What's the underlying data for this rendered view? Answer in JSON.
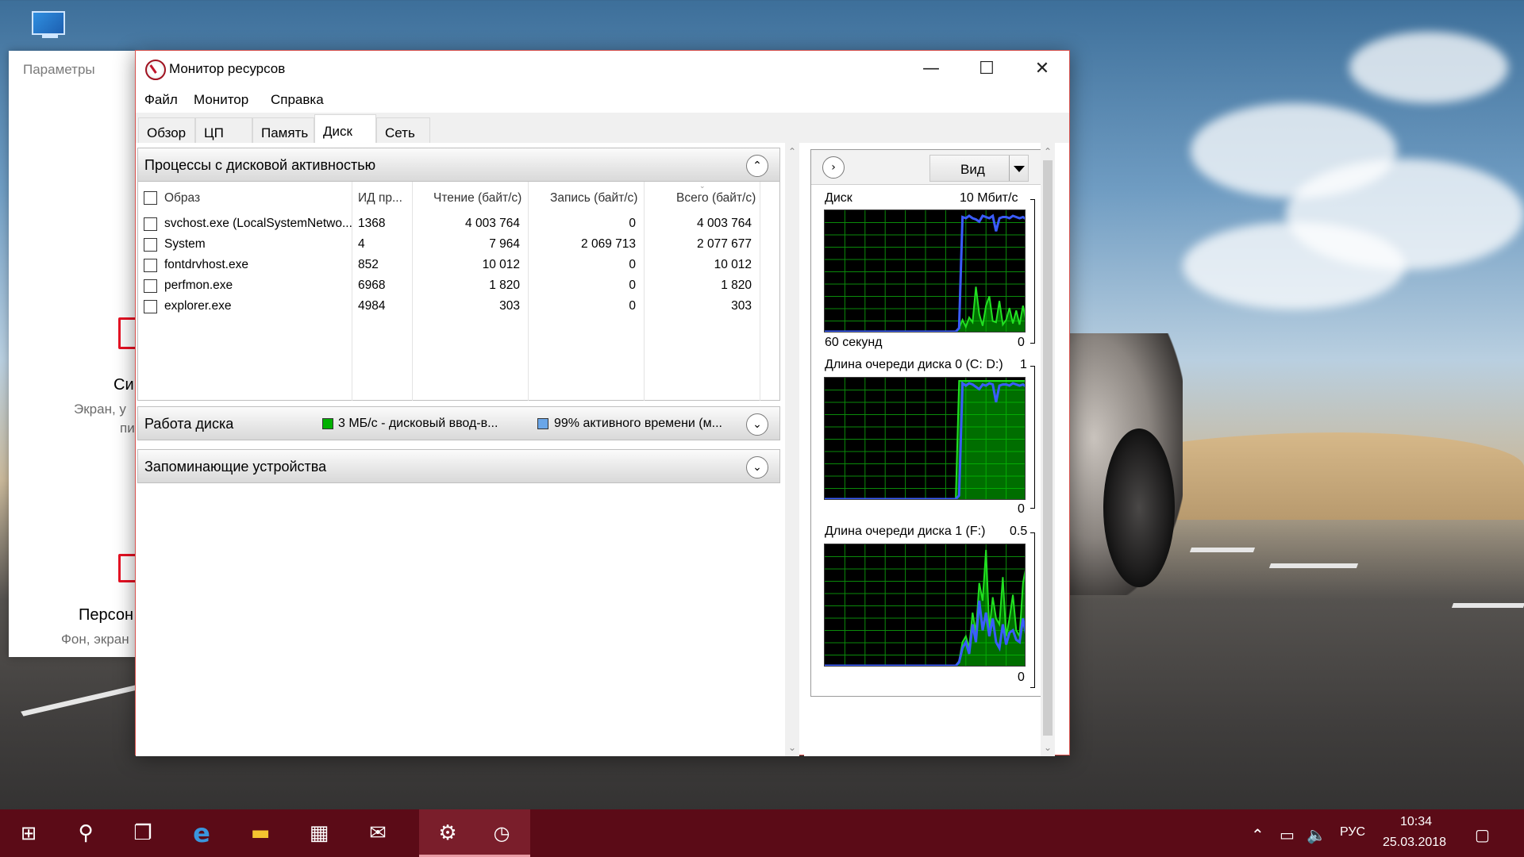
{
  "desktop": {
    "icon": "computer-icon"
  },
  "settings_window": {
    "title": "Параметры",
    "item1_title": "Си",
    "item1_sub_line1": "Экран, у",
    "item1_sub_line2": "пи",
    "item2_title": "Персон",
    "item2_sub": "Фон, экран"
  },
  "window": {
    "title": "Монитор ресурсов",
    "minimize": "—",
    "maximize": "☐",
    "close": "✕",
    "menu": [
      "Файл",
      "Монитор",
      "Справка"
    ],
    "tabs": [
      "Обзор",
      "ЦП",
      "Память",
      "Диск",
      "Сеть"
    ],
    "active_tab": "Диск"
  },
  "processes": {
    "title": "Процессы с дисковой активностью",
    "toggle": "⌃",
    "columns": [
      "Образ",
      "ИД пр...",
      "Чтение (байт/с)",
      "Запись (байт/с)",
      "Всего (байт/с)"
    ],
    "rows": [
      [
        "svchost.exe (LocalSystemNetwo...",
        "1368",
        "4 003 764",
        "0",
        "4 003 764"
      ],
      [
        "System",
        "4",
        "7 964",
        "2 069 713",
        "2 077 677"
      ],
      [
        "fontdrvhost.exe",
        "852",
        "10 012",
        "0",
        "10 012"
      ],
      [
        "perfmon.exe",
        "6968",
        "1 820",
        "0",
        "1 820"
      ],
      [
        "explorer.exe",
        "4984",
        "303",
        "0",
        "303"
      ]
    ]
  },
  "disk_activity": {
    "title": "Работа диска",
    "legend1": "3 МБ/с - дисковый ввод-в...",
    "legend1_color": "#00b000",
    "legend2": "99% активного времени (м...",
    "legend2_color": "#6aa6e8",
    "toggle": "⌄"
  },
  "storage": {
    "title": "Запоминающие устройства",
    "toggle": "⌄"
  },
  "right_panel": {
    "view_label": "Вид",
    "graphs": [
      {
        "title": "Диск",
        "max": "10 Мбит/с",
        "bottom_left": "60 секунд",
        "bottom_right": "0",
        "green": [
          0,
          0,
          0,
          0,
          0,
          0,
          0,
          0,
          0,
          0,
          0,
          0,
          0,
          0,
          0,
          0,
          0,
          0,
          0,
          0,
          0,
          0,
          0,
          0,
          0,
          0,
          0,
          0,
          0,
          0,
          0,
          0,
          0,
          0,
          0,
          0,
          0,
          0,
          0,
          0,
          3,
          10,
          4,
          12,
          8,
          38,
          15,
          5,
          22,
          30,
          9,
          8,
          26,
          6,
          10,
          20,
          7,
          18,
          6,
          22,
          8
        ],
        "blue": [
          0,
          0,
          0,
          0,
          0,
          0,
          0,
          0,
          0,
          0,
          0,
          0,
          0,
          0,
          0,
          0,
          0,
          0,
          0,
          0,
          0,
          0,
          0,
          0,
          0,
          0,
          0,
          0,
          0,
          0,
          0,
          0,
          0,
          0,
          0,
          0,
          0,
          0,
          0,
          0,
          3,
          97,
          96,
          98,
          96,
          95,
          93,
          98,
          97,
          96,
          98,
          85,
          96,
          97,
          97,
          96,
          98,
          97,
          96,
          97,
          95
        ]
      },
      {
        "title": "Длина очереди диска 0 (C: D:)",
        "max": "1",
        "bottom_left": "",
        "bottom_right": "0",
        "green": [
          0,
          0,
          0,
          0,
          0,
          0,
          0,
          0,
          0,
          0,
          0,
          0,
          0,
          0,
          0,
          0,
          0,
          0,
          0,
          0,
          0,
          0,
          0,
          0,
          0,
          0,
          0,
          0,
          0,
          0,
          0,
          0,
          0,
          0,
          0,
          0,
          0,
          0,
          0,
          0,
          100,
          100,
          100,
          100,
          100,
          100,
          100,
          100,
          100,
          100,
          100,
          100,
          100,
          100,
          100,
          100,
          100,
          100,
          100,
          100,
          100
        ],
        "blue": [
          0,
          0,
          0,
          0,
          0,
          0,
          0,
          0,
          0,
          0,
          0,
          0,
          0,
          0,
          0,
          0,
          0,
          0,
          0,
          0,
          0,
          0,
          0,
          0,
          0,
          0,
          0,
          0,
          0,
          0,
          0,
          0,
          0,
          0,
          0,
          0,
          0,
          0,
          0,
          0,
          3,
          98,
          96,
          98,
          97,
          95,
          93,
          97,
          96,
          98,
          97,
          82,
          96,
          97,
          97,
          96,
          98,
          97,
          96,
          97,
          95
        ]
      },
      {
        "title": "Длина очереди диска 1 (F:)",
        "max": "0.5",
        "bottom_left": "",
        "bottom_right": "0",
        "green": [
          0,
          0,
          0,
          0,
          0,
          0,
          0,
          0,
          0,
          0,
          0,
          0,
          0,
          0,
          0,
          0,
          0,
          0,
          0,
          0,
          0,
          0,
          0,
          0,
          0,
          0,
          0,
          0,
          0,
          0,
          0,
          0,
          0,
          0,
          0,
          0,
          0,
          0,
          0,
          0,
          4,
          20,
          25,
          15,
          45,
          28,
          70,
          55,
          98,
          30,
          58,
          40,
          35,
          75,
          25,
          40,
          60,
          30,
          25,
          70,
          85
        ],
        "blue": [
          0,
          0,
          0,
          0,
          0,
          0,
          0,
          0,
          0,
          0,
          0,
          0,
          0,
          0,
          0,
          0,
          0,
          0,
          0,
          0,
          0,
          0,
          0,
          0,
          0,
          0,
          0,
          0,
          0,
          0,
          0,
          0,
          0,
          0,
          0,
          0,
          0,
          0,
          0,
          0,
          3,
          15,
          20,
          10,
          35,
          20,
          55,
          30,
          45,
          25,
          40,
          20,
          15,
          35,
          18,
          28,
          30,
          22,
          20,
          40,
          25
        ]
      }
    ]
  },
  "taskbar": {
    "items": [
      "windows-start-icon",
      "search-icon",
      "task-view-icon",
      "edge-icon",
      "file-explorer-icon",
      "store-icon",
      "mail-icon",
      "settings-gear-icon",
      "resource-monitor-icon"
    ],
    "language": "РУС",
    "time": "10:34",
    "date": "25.03.2018"
  }
}
